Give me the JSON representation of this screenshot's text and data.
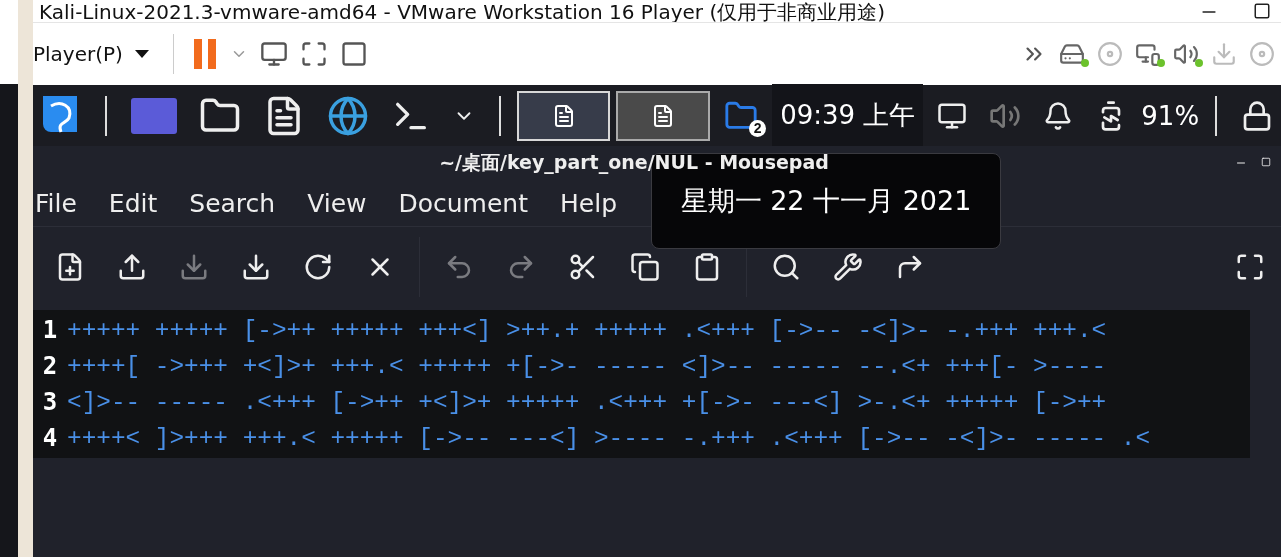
{
  "host_window": {
    "title": "Kali-Linux-2021.3-vmware-amd64 - VMware Workstation 16 Player (仅用于非商业用途)"
  },
  "vm_toolbar": {
    "player_menu": "Player(P)",
    "devices": [
      {
        "connected": true
      },
      {
        "connected": false
      },
      {
        "connected": true
      },
      {
        "connected": true
      },
      {
        "connected": false
      },
      {
        "connected": false
      }
    ]
  },
  "panel": {
    "windows": [
      {
        "selected": true
      },
      {
        "selected": false
      }
    ],
    "workspace_badge": "2",
    "clock": "09:39 上午",
    "battery": "91%"
  },
  "mousepad": {
    "title": "~/桌面/key_part_one/NUL - Mousepad",
    "menu": [
      "File",
      "Edit",
      "Search",
      "View",
      "Document",
      "Help"
    ],
    "toolbar": [
      {
        "disabled": false
      },
      {
        "disabled": false
      },
      {
        "disabled": true
      },
      {
        "disabled": false
      },
      {
        "disabled": false
      },
      {
        "disabled": false
      },
      {
        "disabled": true
      },
      {
        "disabled": true
      },
      {
        "disabled": false
      },
      {
        "disabled": false
      },
      {
        "disabled": false
      },
      {
        "disabled": false
      },
      {
        "disabled": false
      },
      {
        "disabled": false
      }
    ],
    "lines": [
      {
        "number": "1",
        "text": "+++++ +++++ [->++ +++++ +++<] >++.+ +++++ .<+++ [->-- -<]>- -.+++ +++.<"
      },
      {
        "number": "2",
        "text": "++++[ ->+++ +<]>+ +++.< +++++ +[->- ----- <]>-- ----- --.<+ +++[- >----"
      },
      {
        "number": "3",
        "text": "<]>-- ----- .<+++ [->++ +<]>+ +++++ .<+++ +[->- ---<] >-.<+ +++++ [->++"
      },
      {
        "number": "4",
        "text": "++++< ]>+++ +++.< +++++ [->-- ---<] >---- -.+++ .<+++ [->-- -<]>- ----- .<"
      }
    ]
  },
  "tooltip": {
    "text": "星期一 22 十一月 2021"
  }
}
